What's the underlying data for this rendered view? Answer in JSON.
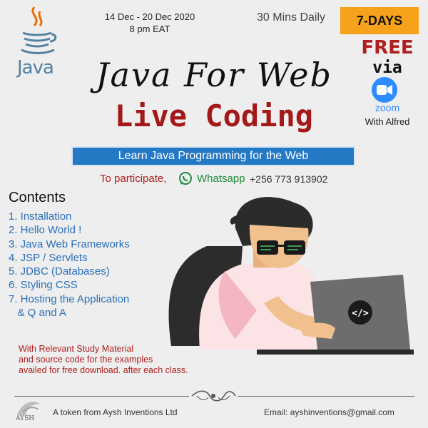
{
  "header": {
    "dates": "14 Dec - 20 Dec 2020",
    "time": "8 pm EAT",
    "duration": "30 Mins Daily",
    "badge": "7-DAYS",
    "free": "FREE",
    "via": "via",
    "zoom": "zoom",
    "with": "With Alfred",
    "java_logo_text": "Java"
  },
  "title": {
    "script": "Java For Web",
    "main": "Live Coding",
    "banner": "Learn Java Programming for the Web"
  },
  "contact": {
    "participate": "To participate,",
    "whatsapp_label": "Whatsapp",
    "whatsapp_number": "+256 773 913902"
  },
  "contents": {
    "heading": "Contents",
    "items": [
      "1. Installation",
      "2. Hello World !",
      "3. Java Web Frameworks",
      "4. JSP / Servlets",
      "5. JDBC (Databases)",
      "6. Styling CSS",
      "7. Hosting the Application",
      "   & Q and A"
    ]
  },
  "material": {
    "line1": "With Relevant Study Material",
    "line2": "and source code for the examples",
    "line3": "availed for free download. after each class."
  },
  "footer": {
    "left": "A token from Aysh Inventions Ltd",
    "right": "Email: ayshinventions@gmail.com",
    "logo_text": "AYSH"
  },
  "laptop_symbol": "</>",
  "colors": {
    "accent_red": "#a31818",
    "banner_blue": "#2479c4",
    "badge_orange": "#f7a21b",
    "list_blue": "#2a6fb8",
    "whatsapp_green": "#1e8a3a",
    "zoom_blue": "#2d8cff"
  }
}
